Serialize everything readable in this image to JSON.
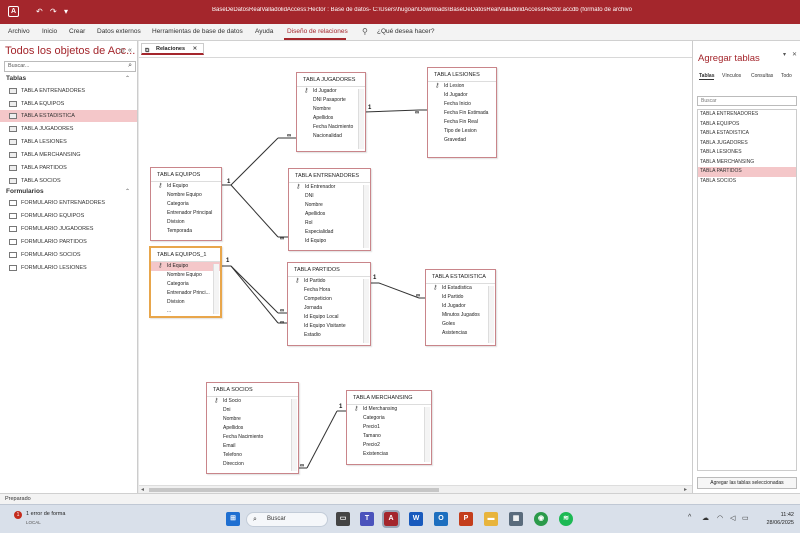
{
  "window": {
    "title": "BaseDeDatosRealValladolidAccess:Hector : Base de datos- C:\\Users\\hugoar\\Downloads\\BaseDeDatosRealValladolidAccessHector.accdb (formato de archivo de Access 2007 - 2016) - Access",
    "quick_access": [
      "↶",
      "↷"
    ]
  },
  "menu": {
    "items": [
      "Archivo",
      "Inicio",
      "Crear",
      "Datos externos",
      "Herramientas de base de datos",
      "Ayuda",
      "Diseño de relaciones"
    ],
    "active": "Diseño de relaciones",
    "tell_me": "¿Qué desea hacer?"
  },
  "nav": {
    "title": "Todos los objetos de Acc...",
    "search_placeholder": "Buscar...",
    "sections": [
      {
        "label": "Tablas",
        "items": [
          "TABLA ENTRENADORES",
          "TABLA EQUIPOS",
          "TABLA ESTADISTICA",
          "TABLA JUGADORES",
          "TABLA LESIONES",
          "TABLA MERCHANSING",
          "TABLA PARTIDOS",
          "TABLA SOCIOS"
        ],
        "selected": "TABLA ESTADISTICA"
      },
      {
        "label": "Formularios",
        "items": [
          "FORMULARIO ENTRENADORES",
          "FORMULARIO EQUIPOS",
          "FORMULARIO JUGADORES",
          "FORMULARIO PARTIDOS",
          "FORMULARIO SOCIOS",
          "FORMULARIO LESIONES"
        ]
      }
    ]
  },
  "document": {
    "tab_label": "Relaciones"
  },
  "tables": {
    "jugadores": {
      "title": "TABLA JUGADORES",
      "fields": [
        "Id Jugador",
        "DNI Pasaporte",
        "Nombre",
        "Apellidos",
        "Fecha Nacimiento",
        "Nacionalidad"
      ]
    },
    "lesiones": {
      "title": "TABLA LESIONES",
      "fields": [
        "Id Lesion",
        "Id Jugador",
        "Fecha Inicio",
        "Fecha Fin Estimada",
        "Fecha Fin Real",
        "Tipo de Lesion",
        "Gravedad"
      ]
    },
    "equipos": {
      "title": "TABLA EQUIPOS",
      "fields": [
        "Id Equipo",
        "Nombre Equipo",
        "Categoria",
        "Entrenador Principal",
        "Division",
        "Temporada"
      ]
    },
    "entrenadores": {
      "title": "TABLA ENTRENADORES",
      "fields": [
        "Id Entrenador",
        "DNI",
        "Nombre",
        "Apellidos",
        "Rol",
        "Especialidad",
        "Id Equipo"
      ]
    },
    "equipos1": {
      "title": "TABLA EQUIPOS_1",
      "fields": [
        "Id Equipo",
        "Nombre Equipo",
        "Categoria",
        "Entrenador Princi...",
        "Division",
        "..."
      ]
    },
    "partidos": {
      "title": "TABLA PARTIDOS",
      "fields": [
        "Id Partido",
        "Fecha Hora",
        "Competicion",
        "Jornada",
        "Id Equipo Local",
        "Id Equipo Visitante",
        "Estadio"
      ]
    },
    "estadistica": {
      "title": "TABLA ESTADISTICA",
      "fields": [
        "Id Estadistica",
        "Id Partido",
        "Id Jugador",
        "Minutos Jugados",
        "Goles",
        "Asistencias"
      ]
    },
    "socios": {
      "title": "TABLA SOCIOS",
      "fields": [
        "Id Socio",
        "Dni",
        "Nombre",
        "Apellidos",
        "Fecha Nacimiento",
        "Email",
        "Telefono",
        "Direccion"
      ]
    },
    "merchansing": {
      "title": "TABLA MERCHANSING",
      "fields": [
        "Id Merchansing",
        "Categoria",
        "Precio1",
        "Tamano",
        "Precio2",
        "Existencias"
      ]
    }
  },
  "relationship_labels": {
    "one": "1",
    "many": "∞"
  },
  "right_pane": {
    "title": "Agregar tablas",
    "tabs": [
      "Tablas",
      "Vínculos",
      "Consultas",
      "Todo"
    ],
    "active_tab": "Tablas",
    "search_placeholder": "Buscar",
    "items": [
      "TABLA ENTRENADORES",
      "TABLA EQUIPOS",
      "TABLA ESTADISTICA",
      "TABLA JUGADORES",
      "TABLA LESIONES",
      "TABLA MERCHANSING",
      "TABLA PARTIDOS",
      "TABLA SOCIOS"
    ],
    "selected": "TABLA PARTIDOS",
    "add_button": "Agregar las tablas seleccionadas"
  },
  "status": {
    "text": "Preparado"
  },
  "taskbar": {
    "notification_count": "1",
    "notification_text": "1 error de forma",
    "notification_sub": "LOCAL",
    "search_label": "Buscar",
    "time": "11:42",
    "date": "28/06/2025"
  }
}
